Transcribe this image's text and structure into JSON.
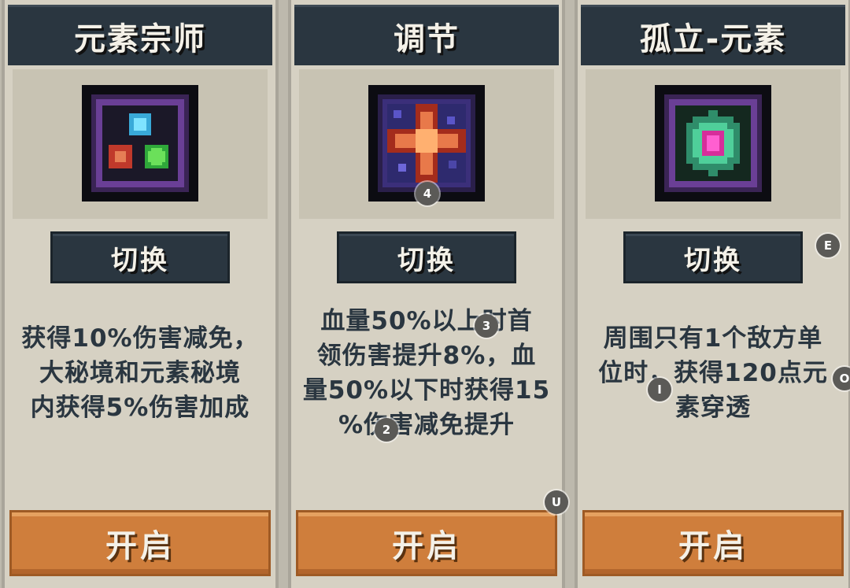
{
  "cards": [
    {
      "title": "元素宗师",
      "icon": "elemental-master-icon",
      "switch_label": "切换",
      "description": [
        "获得10%伤害减免，",
        "大秘境和元素秘境",
        "内获得5%伤害加成"
      ],
      "open_label": "开启"
    },
    {
      "title": "调节",
      "icon": "adjust-icon",
      "switch_label": "切换",
      "description": [
        "血量50%以上时首",
        "领伤害提升8%，血",
        "量50%以下时获得15",
        "%伤害减免提升"
      ],
      "open_label": "开启"
    },
    {
      "title": "孤立-元素",
      "icon": "isolated-element-icon",
      "switch_label": "切换",
      "description": [
        "周围只有1个敌方单",
        "位时，获得120点元",
        "素穿透"
      ],
      "open_label": "开启"
    }
  ],
  "markers": [
    "4",
    "3",
    "2",
    "U",
    "E",
    "I",
    "O"
  ]
}
